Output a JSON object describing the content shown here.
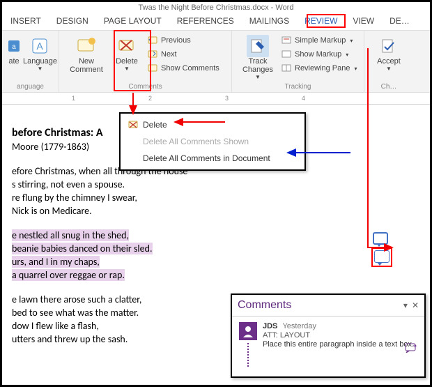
{
  "window": {
    "title": "Twas the Night Before Christmas.docx - Word"
  },
  "ribbon": {
    "tabs": [
      "INSERT",
      "DESIGN",
      "PAGE LAYOUT",
      "REFERENCES",
      "MAILINGS",
      "REVIEW",
      "VIEW",
      "DE…"
    ],
    "active_index": 5,
    "groups": {
      "language": {
        "translate": "ate",
        "button": "Language",
        "label": "anguage"
      },
      "comments": {
        "new_comment": "New Comment",
        "delete": "Delete",
        "previous": "Previous",
        "next": "Next",
        "show_comments": "Show Comments",
        "label": "Comments"
      },
      "tracking": {
        "track_changes": "Track Changes",
        "simple_markup": "Simple Markup",
        "show_markup": "Show Markup",
        "reviewing_pane": "Reviewing Pane",
        "label": "Tracking"
      },
      "changes": {
        "accept": "Accept",
        "label": "Ch…"
      }
    }
  },
  "ruler": {
    "marks": [
      "1",
      "2",
      "3",
      "4"
    ]
  },
  "delete_menu": {
    "items": [
      {
        "label": "Delete",
        "enabled": true
      },
      {
        "label": "Delete All Comments Shown",
        "enabled": false
      },
      {
        "label": "Delete All Comments in Document",
        "enabled": true
      }
    ]
  },
  "document": {
    "title": "before Christmas: A",
    "subtitle": "Moore (1779-1863)",
    "stanza1": [
      "efore Christmas, when all through the house",
      "s stirring, not even a spouse.",
      "re flung by the chimney I swear,",
      "Nick is on Medicare."
    ],
    "stanza2": [
      "e nestled all snug in the shed,",
      "beanie babies danced on their sled.",
      "urs, and I in my chaps,",
      "a quarrel over reggae or rap."
    ],
    "stanza3": [
      "e lawn there arose such a clatter,",
      "bed to see what was the matter.",
      "dow I flew like a flash,",
      "utters and threw up the sash."
    ]
  },
  "comments_pane": {
    "title": "Comments",
    "author": "JDS",
    "time": "Yesterday",
    "att": "ATT: LAYOUT",
    "text": "Place this entire paragraph inside a text box."
  },
  "colors": {
    "accent_purple": "#6b2f8a",
    "highlight_lavender": "#e8d2eb",
    "red": "#f00000",
    "blue": "#0020d0",
    "word_tab_blue": "#2a5db0"
  }
}
